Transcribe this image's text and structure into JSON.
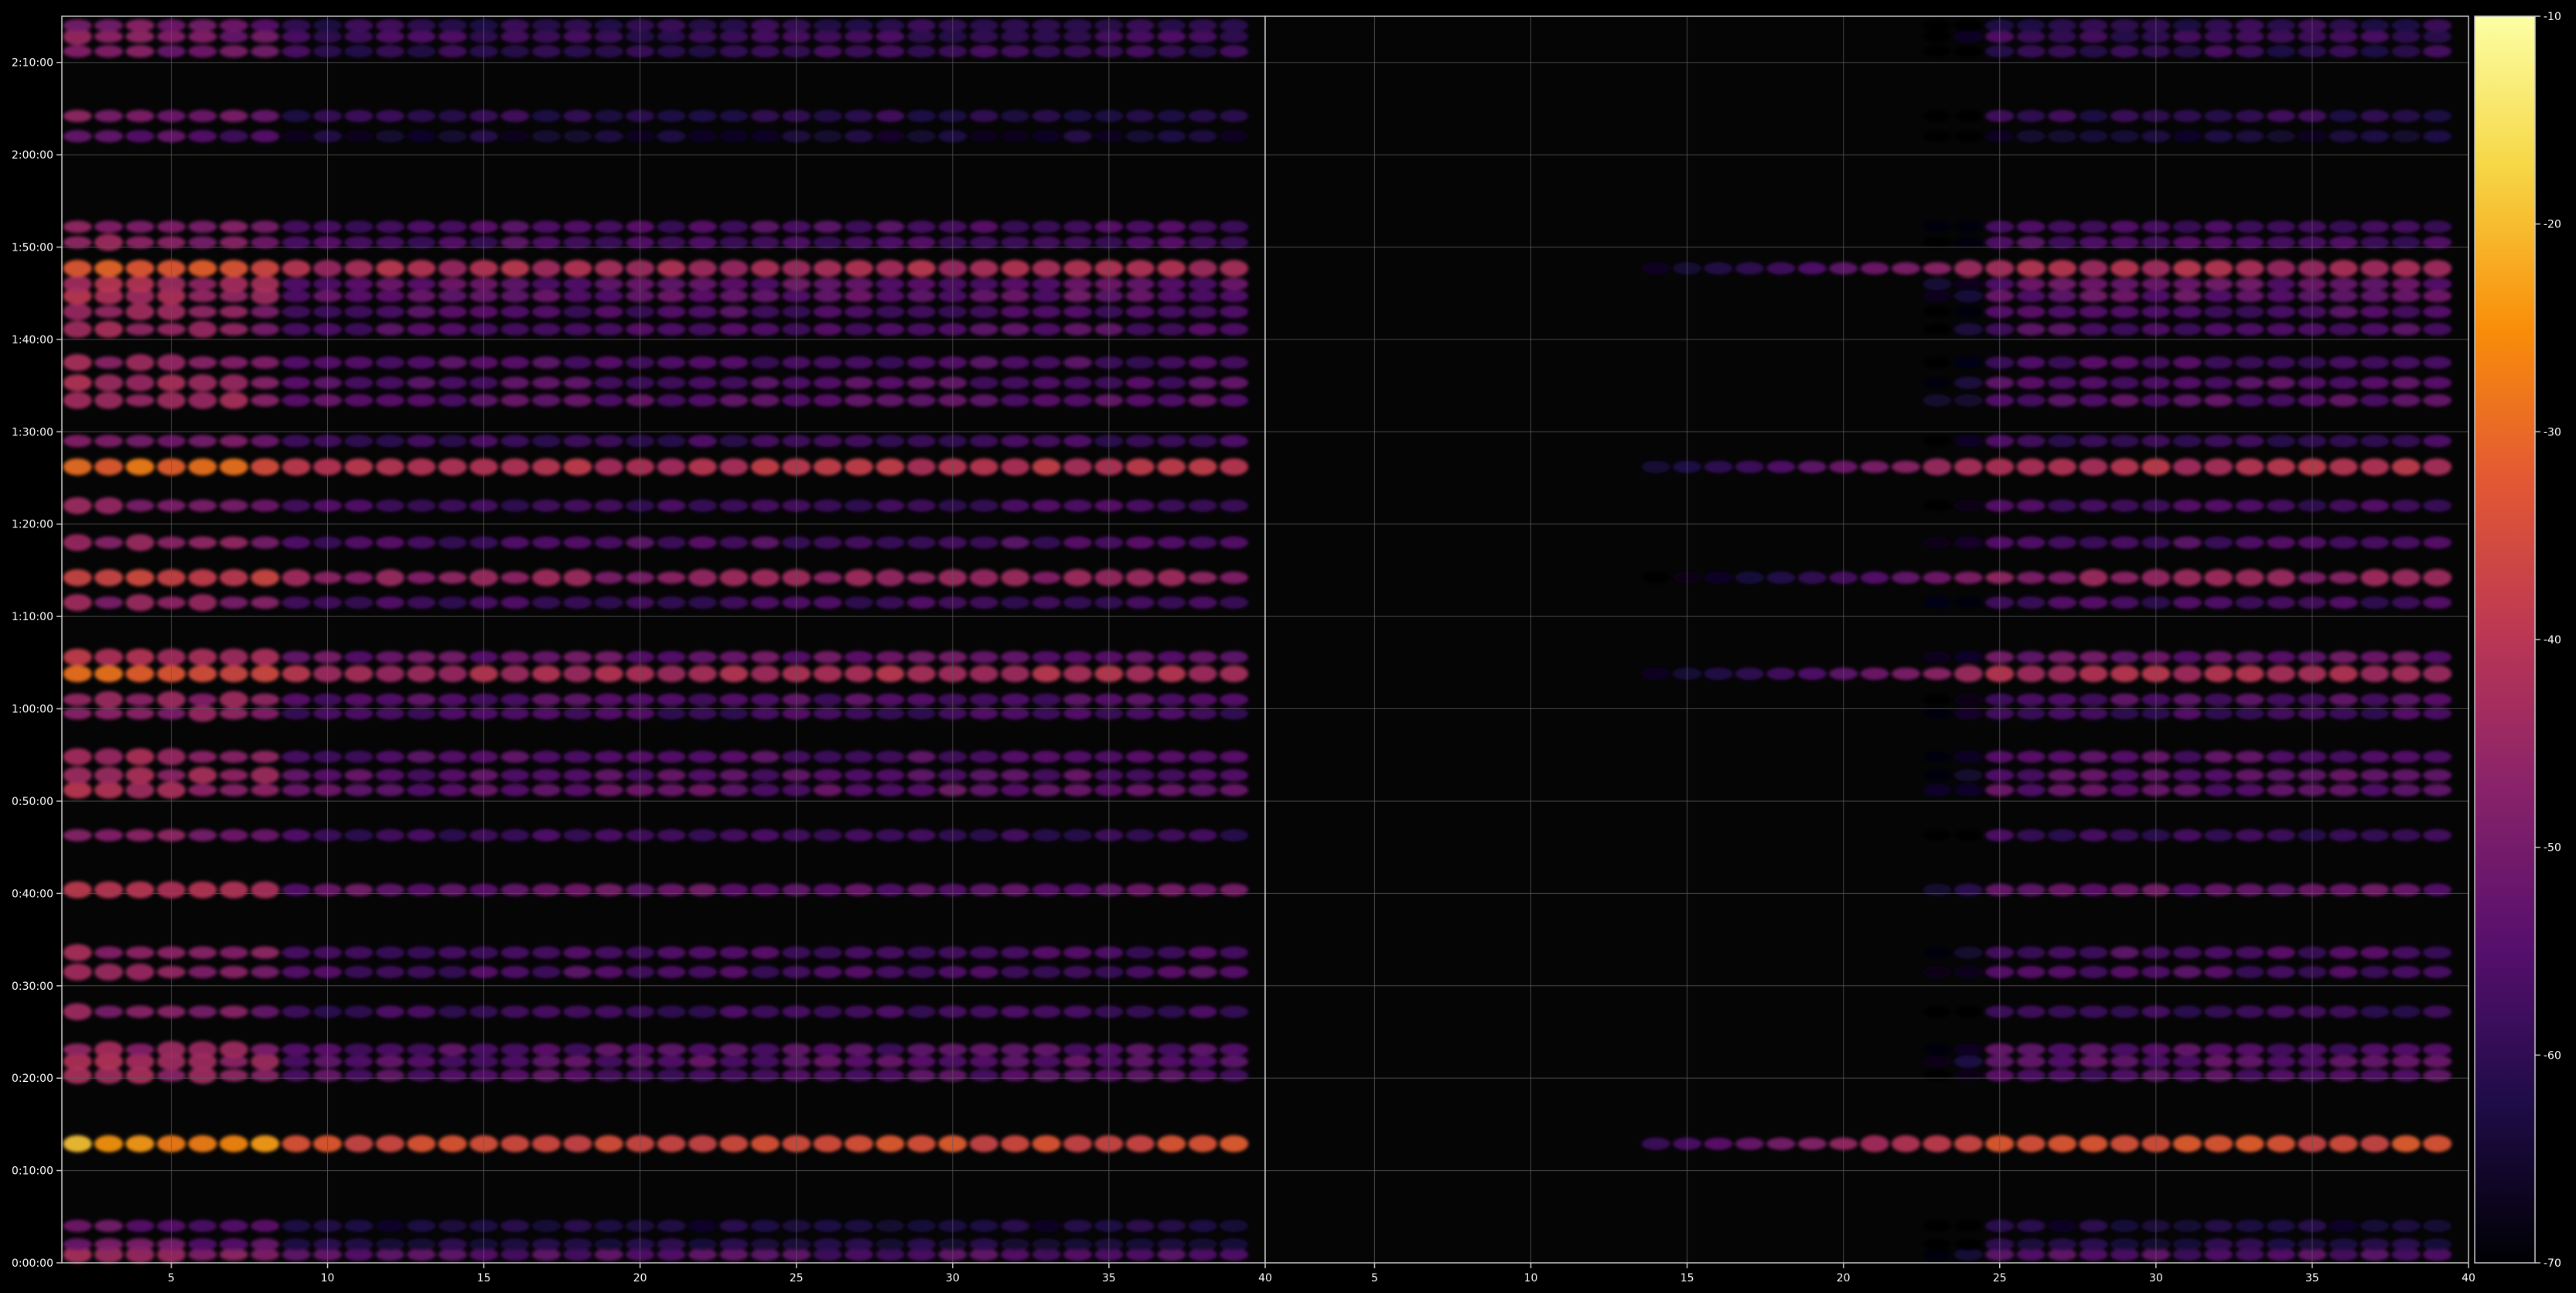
{
  "chart_data": {
    "type": "heatmap",
    "title": "",
    "xlabel": "",
    "ylabel": "",
    "panels": [
      {
        "name": "",
        "x_range": [
          1.5,
          40
        ],
        "x_ticks": [
          {
            "value": 5,
            "label": "5"
          },
          {
            "value": 10,
            "label": "10"
          },
          {
            "value": 15,
            "label": "15"
          },
          {
            "value": 20,
            "label": "20"
          },
          {
            "value": 25,
            "label": "25"
          },
          {
            "value": 30,
            "label": "30"
          },
          {
            "value": 35,
            "label": "35"
          },
          {
            "value": 40,
            "label": "40"
          }
        ],
        "activity_start_column": 1
      },
      {
        "name": "",
        "x_range": [
          1.5,
          40
        ],
        "x_ticks": [
          {
            "value": 5,
            "label": "5"
          },
          {
            "value": 10,
            "label": "10"
          },
          {
            "value": 15,
            "label": "15"
          },
          {
            "value": 20,
            "label": "20"
          },
          {
            "value": 25,
            "label": "25"
          },
          {
            "value": 30,
            "label": "30"
          },
          {
            "value": 35,
            "label": "35"
          },
          {
            "value": 40,
            "label": "40"
          }
        ],
        "activity_start_column": 25
      }
    ],
    "y_axis": {
      "unit": "minutes",
      "range": [
        0,
        135
      ],
      "ticks": [
        {
          "value": 0,
          "label": "0:00:00"
        },
        {
          "value": 10,
          "label": "0:10:00"
        },
        {
          "value": 20,
          "label": "0:20:00"
        },
        {
          "value": 30,
          "label": "0:30:00"
        },
        {
          "value": 40,
          "label": "0:40:00"
        },
        {
          "value": 50,
          "label": "0:50:00"
        },
        {
          "value": 60,
          "label": "1:00:00"
        },
        {
          "value": 70,
          "label": "1:10:00"
        },
        {
          "value": 80,
          "label": "1:20:00"
        },
        {
          "value": 90,
          "label": "1:30:00"
        },
        {
          "value": 100,
          "label": "1:40:00"
        },
        {
          "value": 110,
          "label": "1:50:00"
        },
        {
          "value": 120,
          "label": "2:00:00"
        },
        {
          "value": 130,
          "label": "2:10:00"
        }
      ]
    },
    "rows": [
      {
        "t": 0.9,
        "level": -55
      },
      {
        "t": 2.0,
        "level": -62
      },
      {
        "t": 4.0,
        "level": -63
      },
      {
        "t": 12.9,
        "level": -34
      },
      {
        "t": 20.3,
        "level": -55
      },
      {
        "t": 21.8,
        "level": -54
      },
      {
        "t": 23.1,
        "level": -55
      },
      {
        "t": 27.2,
        "level": -58
      },
      {
        "t": 31.5,
        "level": -56
      },
      {
        "t": 33.6,
        "level": -56
      },
      {
        "t": 40.4,
        "level": -52
      },
      {
        "t": 46.3,
        "level": -58
      },
      {
        "t": 51.2,
        "level": -53
      },
      {
        "t": 52.8,
        "level": -54
      },
      {
        "t": 54.8,
        "level": -55
      },
      {
        "t": 59.5,
        "level": -57
      },
      {
        "t": 61.0,
        "level": -55
      },
      {
        "t": 63.8,
        "level": -42
      },
      {
        "t": 65.6,
        "level": -52
      },
      {
        "t": 71.5,
        "level": -57
      },
      {
        "t": 74.2,
        "level": -46
      },
      {
        "t": 78.0,
        "level": -56
      },
      {
        "t": 82.0,
        "level": -57
      },
      {
        "t": 86.2,
        "level": -40
      },
      {
        "t": 89.0,
        "level": -58
      },
      {
        "t": 93.4,
        "level": -54
      },
      {
        "t": 95.3,
        "level": -55
      },
      {
        "t": 97.5,
        "level": -56
      },
      {
        "t": 101.1,
        "level": -55
      },
      {
        "t": 103.0,
        "level": -56
      },
      {
        "t": 104.7,
        "level": -53
      },
      {
        "t": 106.0,
        "level": -53
      },
      {
        "t": 107.7,
        "level": -42
      },
      {
        "t": 110.5,
        "level": -56
      },
      {
        "t": 112.2,
        "level": -56
      },
      {
        "t": 122.0,
        "level": -64
      },
      {
        "t": 124.2,
        "level": -60
      },
      {
        "t": 131.2,
        "level": -59
      },
      {
        "t": 132.8,
        "level": -58
      },
      {
        "t": 134.0,
        "level": -60
      }
    ],
    "colorbar": {
      "colormap": "inferno",
      "range": [
        -70,
        -10
      ],
      "ticks": [
        {
          "value": -10,
          "label": "-10"
        },
        {
          "value": -20,
          "label": "-20"
        },
        {
          "value": -30,
          "label": "-30"
        },
        {
          "value": -40,
          "label": "-40"
        },
        {
          "value": -50,
          "label": "-50"
        },
        {
          "value": -60,
          "label": "-60"
        },
        {
          "value": -70,
          "label": "-70"
        }
      ]
    },
    "grid": true,
    "colors": {
      "background": "#000000",
      "plot_background": "#050506",
      "grid": "#5a5a5a",
      "axes": "#c8c8c8",
      "text": "#ffffff"
    }
  }
}
